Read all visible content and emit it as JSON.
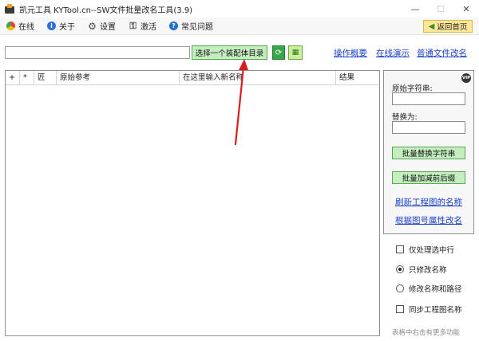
{
  "window": {
    "title": "凯元工具 KYTool.cn--SW文件批量改名工具(3.9)",
    "minimize": "—",
    "maximize": "☐",
    "close": "✕"
  },
  "menu": {
    "items": [
      "在线",
      "关于",
      "设置",
      "激活",
      "常见问题"
    ],
    "back_home": "返回首页"
  },
  "toolbar": {
    "path_value": "",
    "select_dir_label": "选择一个装配体目录",
    "refresh_icon": "⟳",
    "open_icon": "▦",
    "links": [
      "操作概要",
      "在线演示",
      "普通文件改名"
    ]
  },
  "table": {
    "columns": [
      "+",
      "*",
      "匠",
      "原始参考",
      "在这里输入新名称",
      "结果"
    ],
    "rows": []
  },
  "side": {
    "vip": "VIP",
    "original_label": "原始字符串:",
    "original_value": "",
    "replace_label": "替换为:",
    "replace_value": "",
    "batch_replace_btn": "批量替换字符串",
    "batch_affix_btn": "批量加减前后缀",
    "refresh_names_link": "刷新工程图的名称",
    "rename_by_props_link": "根据图号属性改名"
  },
  "options": {
    "selected_rows_only": "仅处理选中行",
    "rename_only": "只修改名称",
    "rename_and_path": "修改名称和路径",
    "sync_drawing_name": "同步工程图名称",
    "hint": "表格中右击有更多功能"
  },
  "colors": {
    "green_button": "#c5eec0",
    "link_blue": "#1a3fc7",
    "annotation_red": "#d62020"
  }
}
